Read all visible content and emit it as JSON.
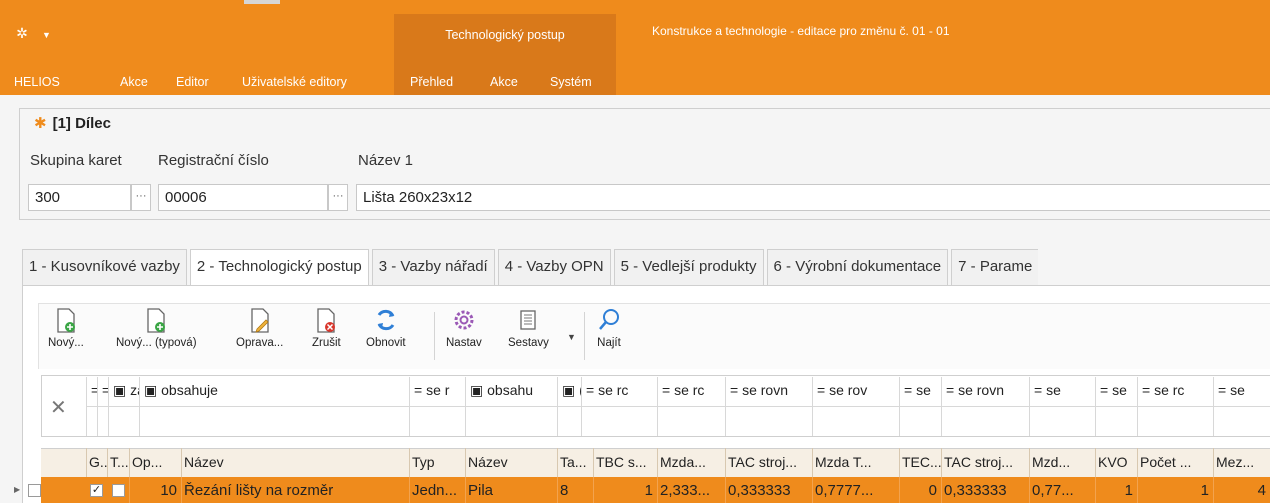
{
  "ribbon": {
    "contextual_tab_header": "Technologický postup",
    "window_title": "Konstrukce a technologie - editace pro změnu č. 01 - 01",
    "menu": [
      "HELIOS",
      "Akce",
      "Editor",
      "Uživatelské editory"
    ],
    "context_menu": [
      "Přehled",
      "Akce",
      "Systém"
    ]
  },
  "header": {
    "group_title": "[1] Dílec",
    "labels": {
      "skupina_karet": "Skupina karet",
      "registracni_cislo": "Registrační číslo",
      "nazev1": "Název 1"
    },
    "values": {
      "skupina_karet": "300",
      "registracni_cislo": "00006",
      "nazev1": "Lišta 260x23x12"
    },
    "ellipsis": "···"
  },
  "tabs": [
    "1 - Kusovníkové vazby",
    "2 - Technologický postup",
    "3 - Vazby nářadí",
    "4 - Vazby OPN",
    "5 - Vedlejší produkty",
    "6 - Výrobní dokumentace",
    "7 - Parame"
  ],
  "active_tab_index": 1,
  "toolbar": {
    "buttons": [
      "Nový...",
      "Nový... (typová)",
      "Oprava...",
      "Zrušit",
      "Obnovit",
      "Nastav",
      "Sestavy",
      "Najít"
    ],
    "icons": [
      "new-document-icon",
      "new-typed-document-icon",
      "edit-document-icon",
      "delete-document-icon",
      "refresh-icon",
      "settings-gear-icon",
      "reports-icon",
      "search-icon"
    ]
  },
  "grid": {
    "clear_filter": "✕",
    "filters": [
      "=",
      "=",
      "▣ zą",
      "▣ obsahuje",
      "= se r",
      "▣ obsahu",
      "▣ (",
      "= se rc",
      "= se rc",
      "= se rovn",
      "= se rov",
      "= se",
      "= se rovn",
      "= se",
      "= se",
      "= se rc",
      "= se"
    ],
    "columns": [
      "G...",
      "T...",
      "Op...",
      "Název",
      "Typ",
      "Název",
      "Ta...",
      "TBC s...",
      "Mzda...",
      "TAC stroj...",
      "Mzda T...",
      "TEC...",
      "TAC stroj...",
      "Mzd...",
      "KVO",
      "Počet ...",
      "Mez..."
    ],
    "rows": [
      {
        "g_checked": true,
        "t_checked": false,
        "cells": [
          "10",
          "Řezání lišty na rozměr",
          "Jedn...",
          "Pila",
          "8",
          "1",
          "2,333...",
          "0,333333",
          "0,7777...",
          "0",
          "0,333333",
          "0,77...",
          "1",
          "1",
          "4"
        ]
      }
    ]
  }
}
